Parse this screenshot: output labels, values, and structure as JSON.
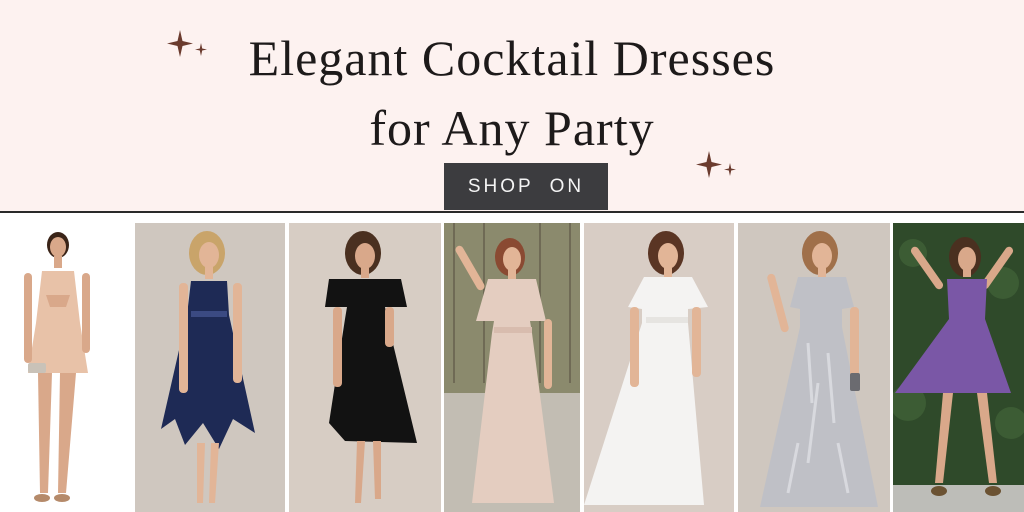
{
  "hero": {
    "headline_line1": "Elegant Cocktail Dresses",
    "headline_line2": "for Any Party",
    "cta_label": "SHOP ON",
    "sparkle_color": "#6b3b2e"
  },
  "products": [
    {
      "name": "blush-cutout-mini-dress",
      "dress_color": "#e8c2a8",
      "bg": "#ffffff"
    },
    {
      "name": "navy-handkerchief-hem-dress",
      "dress_color": "#1e2a55",
      "bg": "#cfc7bf"
    },
    {
      "name": "black-flutter-sleeve-dress",
      "dress_color": "#121212",
      "bg": "#d7cdc4"
    },
    {
      "name": "blush-tulle-maxi-dress",
      "dress_color": "#e4cdc0",
      "bg": "#a7a188"
    },
    {
      "name": "white-chiffon-gown",
      "dress_color": "#f4f3f2",
      "bg": "#d8cdc5"
    },
    {
      "name": "silver-sequin-tulle-gown",
      "dress_color": "#bfc0c6",
      "bg": "#cfc7bf"
    },
    {
      "name": "purple-skater-dress",
      "dress_color": "#7a57a6",
      "bg": "#2f4a2a"
    }
  ]
}
